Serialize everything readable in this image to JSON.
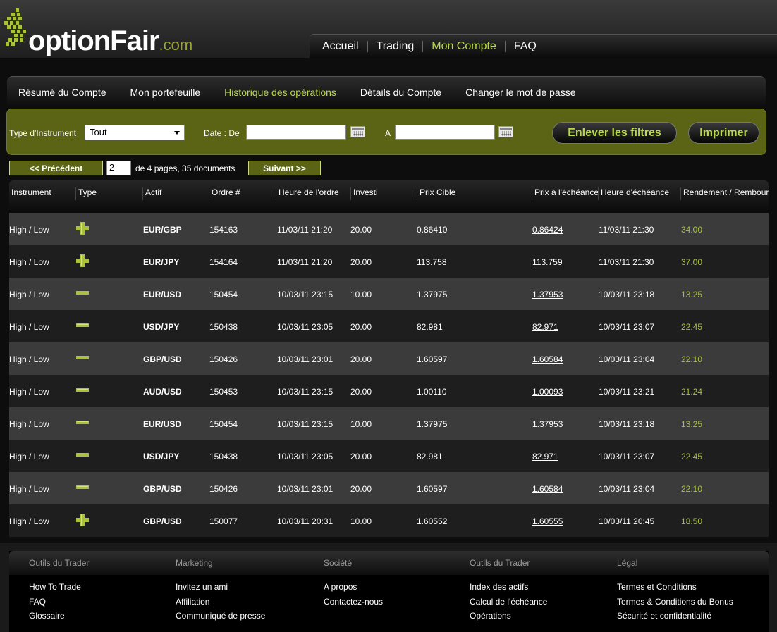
{
  "brand": {
    "name": "optionFair",
    "suffix": ".com",
    "accent": "#b8d94a",
    "olive": "#5a6414"
  },
  "top_nav": [
    {
      "label": "Accueil",
      "active": false
    },
    {
      "label": "Trading",
      "active": false
    },
    {
      "label": "Mon Compte",
      "active": true
    },
    {
      "label": "FAQ",
      "active": false
    }
  ],
  "sub_nav": [
    {
      "label": "Résumé du Compte",
      "active": false
    },
    {
      "label": "Mon portefeuille",
      "active": false
    },
    {
      "label": "Historique des opérations",
      "active": true
    },
    {
      "label": "Détails du Compte",
      "active": false
    },
    {
      "label": "Changer le mot de passe",
      "active": false
    }
  ],
  "filters": {
    "instrument_label": "Type d'Instrument",
    "instrument_value": "Tout",
    "date_from_label": "Date : De",
    "date_to_label": "A",
    "date_from_value": "",
    "date_to_value": "",
    "clear_label": "Enlever les filtres",
    "print_label": "Imprimer"
  },
  "pagination": {
    "prev_label": "<< Précédent",
    "next_label": "Suivant >>",
    "current_page": "2",
    "info": "de 4 pages, 35 documents"
  },
  "table": {
    "columns": [
      "Instrument",
      "Type",
      "Actif",
      "Ordre #",
      "Heure de l'ordre",
      "Investi",
      "Prix Cible",
      "Prix à l'échéance",
      "Heure d'échéance",
      "Rendement / Remboursement"
    ],
    "rows": [
      {
        "instrument": "High / Low",
        "type_icon": "plus-icon",
        "actif": "EUR/GBP",
        "ordre": "154163",
        "heure_ordre": "11/03/11 21:20",
        "investi": "20.00",
        "prix_cible": "0.86410",
        "prix_echeance": "0.86424",
        "heure_echeance": "11/03/11 21:30",
        "rendement": "34.00"
      },
      {
        "instrument": "High / Low",
        "type_icon": "plus-icon",
        "actif": "EUR/JPY",
        "ordre": "154164",
        "heure_ordre": "11/03/11 21:20",
        "investi": "20.00",
        "prix_cible": "113.758",
        "prix_echeance": "113.759",
        "heure_echeance": "11/03/11 21:30",
        "rendement": "37.00"
      },
      {
        "instrument": "High / Low",
        "type_icon": "minus-icon",
        "actif": "EUR/USD",
        "ordre": "150454",
        "heure_ordre": "10/03/11 23:15",
        "investi": "10.00",
        "prix_cible": "1.37975",
        "prix_echeance": "1.37953",
        "heure_echeance": "10/03/11 23:18",
        "rendement": "13.25"
      },
      {
        "instrument": "High / Low",
        "type_icon": "minus-icon",
        "actif": "USD/JPY",
        "ordre": "150438",
        "heure_ordre": "10/03/11 23:05",
        "investi": "20.00",
        "prix_cible": "82.981",
        "prix_echeance": "82.971",
        "heure_echeance": "10/03/11 23:07",
        "rendement": "22.45"
      },
      {
        "instrument": "High / Low",
        "type_icon": "minus-icon",
        "actif": "GBP/USD",
        "ordre": "150426",
        "heure_ordre": "10/03/11 23:01",
        "investi": "20.00",
        "prix_cible": "1.60597",
        "prix_echeance": "1.60584",
        "heure_echeance": "10/03/11 23:04",
        "rendement": "22.10"
      },
      {
        "instrument": "High / Low",
        "type_icon": "minus-icon",
        "actif": "AUD/USD",
        "ordre": "150453",
        "heure_ordre": "10/03/11 23:15",
        "investi": "20.00",
        "prix_cible": "1.00110",
        "prix_echeance": "1.00093",
        "heure_echeance": "10/03/11 23:21",
        "rendement": "21.24"
      },
      {
        "instrument": "High / Low",
        "type_icon": "minus-icon",
        "actif": "EUR/USD",
        "ordre": "150454",
        "heure_ordre": "10/03/11 23:15",
        "investi": "10.00",
        "prix_cible": "1.37975",
        "prix_echeance": "1.37953",
        "heure_echeance": "10/03/11 23:18",
        "rendement": "13.25"
      },
      {
        "instrument": "High / Low",
        "type_icon": "minus-icon",
        "actif": "USD/JPY",
        "ordre": "150438",
        "heure_ordre": "10/03/11 23:05",
        "investi": "20.00",
        "prix_cible": "82.981",
        "prix_echeance": "82.971",
        "heure_echeance": "10/03/11 23:07",
        "rendement": "22.45"
      },
      {
        "instrument": "High / Low",
        "type_icon": "minus-icon",
        "actif": "GBP/USD",
        "ordre": "150426",
        "heure_ordre": "10/03/11 23:01",
        "investi": "20.00",
        "prix_cible": "1.60597",
        "prix_echeance": "1.60584",
        "heure_echeance": "10/03/11 23:04",
        "rendement": "22.10"
      },
      {
        "instrument": "High / Low",
        "type_icon": "plus-icon",
        "actif": "GBP/USD",
        "ordre": "150077",
        "heure_ordre": "10/03/11 20:31",
        "investi": "10.00",
        "prix_cible": "1.60552",
        "prix_echeance": "1.60555",
        "heure_echeance": "10/03/11 20:45",
        "rendement": "18.50"
      }
    ]
  },
  "footer": {
    "columns": [
      {
        "title": "Outils du Trader",
        "links": [
          "How To Trade",
          "FAQ",
          "Glossaire"
        ]
      },
      {
        "title": "Marketing",
        "links": [
          "Invitez un ami",
          "Affiliation",
          "Communiqué de presse"
        ]
      },
      {
        "title": "Société",
        "links": [
          "A propos",
          "Contactez-nous"
        ]
      },
      {
        "title": "Outils du Trader",
        "links": [
          "Index des actifs",
          "Calcul de l'échéance",
          "Opérations"
        ]
      },
      {
        "title": "Légal",
        "links": [
          "Termes et Conditions",
          "Termes & Conditions du Bonus",
          "Sécurité et confidentialité"
        ]
      }
    ]
  }
}
